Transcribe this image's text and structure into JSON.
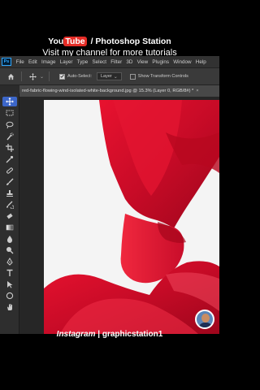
{
  "banner": {
    "yt_you": "You",
    "yt_tube": "Tube",
    "channel_suffix": "/ Photoshop Station",
    "tagline": "Visit my channel for more tutorials"
  },
  "app": {
    "logo": "Ps",
    "menu": [
      "File",
      "Edit",
      "Image",
      "Layer",
      "Type",
      "Select",
      "Filter",
      "3D",
      "View",
      "Plugins",
      "Window",
      "Help"
    ],
    "options": {
      "auto_select_label": "Auto-Select:",
      "auto_select_value": "Layer",
      "transform_label": "Show Transform Controls"
    },
    "document_tab": "red-fabric-flowing-wind-isolated-white-background.jpg @ 15.3% (Layer 0, RGB/8#) *",
    "tab_close": "×",
    "tools": [
      "move-tool-icon",
      "marquee-tool-icon",
      "lasso-tool-icon",
      "quick-selection-tool-icon",
      "crop-tool-icon",
      "eyedropper-tool-icon",
      "spot-healing-tool-icon",
      "brush-tool-icon",
      "clone-stamp-tool-icon",
      "history-brush-tool-icon",
      "eraser-tool-icon",
      "gradient-tool-icon",
      "blur-tool-icon",
      "dodge-tool-icon",
      "pen-tool-icon",
      "type-tool-icon",
      "path-selection-tool-icon",
      "shape-tool-icon"
    ],
    "colors": {
      "accent": "#3c66c8",
      "fabric": "#d0102f",
      "ps_blue": "#31a8ff"
    }
  },
  "footer": {
    "insta_label": "Instagram",
    "separator": "|",
    "handle": "graphicstation1"
  }
}
